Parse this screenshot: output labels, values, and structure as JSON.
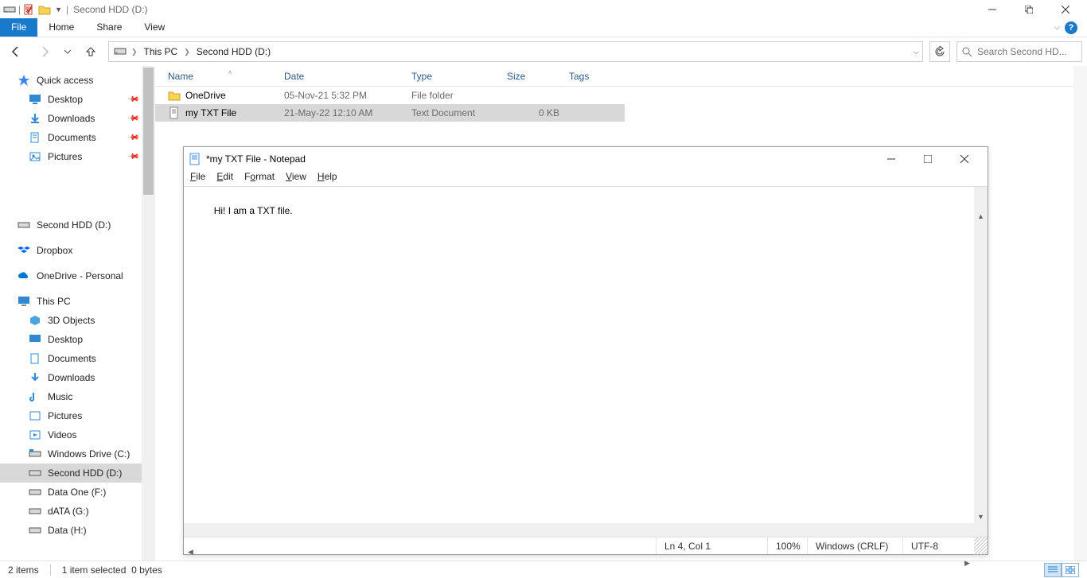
{
  "titlebar": {
    "title": "Second HDD (D:)"
  },
  "ribbon": {
    "file": "File",
    "home": "Home",
    "share": "Share",
    "view": "View"
  },
  "breadcrumb": {
    "root": "This PC",
    "current": "Second HDD (D:)"
  },
  "search": {
    "placeholder": "Search Second HD..."
  },
  "nav": {
    "quick_access": "Quick access",
    "qa_items": [
      {
        "label": "Desktop"
      },
      {
        "label": "Downloads"
      },
      {
        "label": "Documents"
      },
      {
        "label": "Pictures"
      }
    ],
    "second_hdd": "Second HDD (D:)",
    "dropbox": "Dropbox",
    "onedrive": "OneDrive - Personal",
    "this_pc": "This PC",
    "pc_items": [
      "3D Objects",
      "Desktop",
      "Documents",
      "Downloads",
      "Music",
      "Pictures",
      "Videos",
      "Windows Drive (C:)",
      "Second HDD (D:)",
      "Data One (F:)",
      "dATA (G:)",
      "Data (H:)"
    ]
  },
  "columns": {
    "name": "Name",
    "date": "Date",
    "type": "Type",
    "size": "Size",
    "tags": "Tags"
  },
  "rows": [
    {
      "name": "OneDrive",
      "date": "05-Nov-21 5:32 PM",
      "type": "File folder",
      "size": ""
    },
    {
      "name": "my TXT File",
      "date": "21-May-22 12:10 AM",
      "type": "Text Document",
      "size": "0 KB"
    }
  ],
  "status": {
    "count": "2 items",
    "selected": "1 item selected",
    "bytes": "0 bytes"
  },
  "notepad": {
    "title": "*my TXT File - Notepad",
    "menu": {
      "file": "File",
      "edit": "Edit",
      "format": "Format",
      "view": "View",
      "help": "Help"
    },
    "content": "Hi! I am a TXT file.",
    "status": {
      "pos": "Ln 4, Col 1",
      "zoom": "100%",
      "lineend": "Windows (CRLF)",
      "encoding": "UTF-8"
    }
  }
}
